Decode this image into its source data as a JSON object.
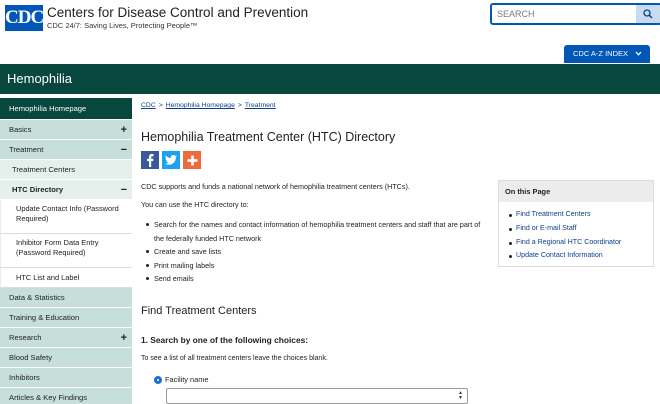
{
  "header": {
    "logo": "CDC",
    "agency": "Centers for Disease Control and Prevention",
    "tagline": "CDC 24/7: Saving Lives, Protecting People™",
    "search_placeholder": "SEARCH",
    "az_label": "CDC A-Z INDEX"
  },
  "title_bar": {
    "title": "Hemophilia"
  },
  "sidebar": {
    "items": [
      {
        "label": "Hemophilia Homepage"
      },
      {
        "label": "Basics",
        "sign": "+"
      },
      {
        "label": "Treatment",
        "sign": "−"
      },
      {
        "label": "Treatment Centers"
      },
      {
        "label": "HTC Directory",
        "sign": "−"
      },
      {
        "label": "Update Contact Info (Password Required)"
      },
      {
        "label": "Inhibitor Form Data Entry (Password Required)"
      },
      {
        "label": "HTC List and Label"
      },
      {
        "label": "Data & Statistics"
      },
      {
        "label": "Training & Education"
      },
      {
        "label": "Research",
        "sign": "+"
      },
      {
        "label": "Blood Safety"
      },
      {
        "label": "Inhibitors"
      },
      {
        "label": "Articles & Key Findings"
      }
    ]
  },
  "breadcrumb": [
    "CDC",
    "Hemophilia Homepage",
    "Treatment"
  ],
  "breadcrumb_sep": ">",
  "main": {
    "title": "Hemophilia Treatment Center (HTC) Directory",
    "intro": "CDC supports and funds a national network of hemophilia treatment centers (HTCs).",
    "use_text": "You can use the HTC directory to:",
    "bullets": [
      "Search for the names and contact information of hemophilia treatment centers and staff that are part of the federally funded HTC network",
      "Create and save lists",
      "Print mailing labels",
      "Send emails"
    ],
    "find_heading": "Find Treatment Centers",
    "search_heading": "1. Search by one of the following choices:",
    "blank_note": "To see a list of all treatment centers leave the choices blank.",
    "radio_label": "Facility name"
  },
  "on_this_page": {
    "heading": "On this Page",
    "links": [
      "Find Treatment Centers",
      "Find or E-mail Staff",
      "Find a Regional HTC Coordinator",
      "Update Contact Information"
    ]
  },
  "colors": {
    "brand_blue": "#0057b7",
    "title_bar_green": "#07473e",
    "sidebar_main": "#c6dfd9",
    "sidebar_sub": "#e5f0ed",
    "link_blue": "#0c3f8a"
  },
  "icons": [
    "search-icon",
    "chevron-down-icon",
    "facebook-icon",
    "twitter-icon",
    "addthis-plus-icon",
    "plus-icon",
    "minus-icon"
  ]
}
